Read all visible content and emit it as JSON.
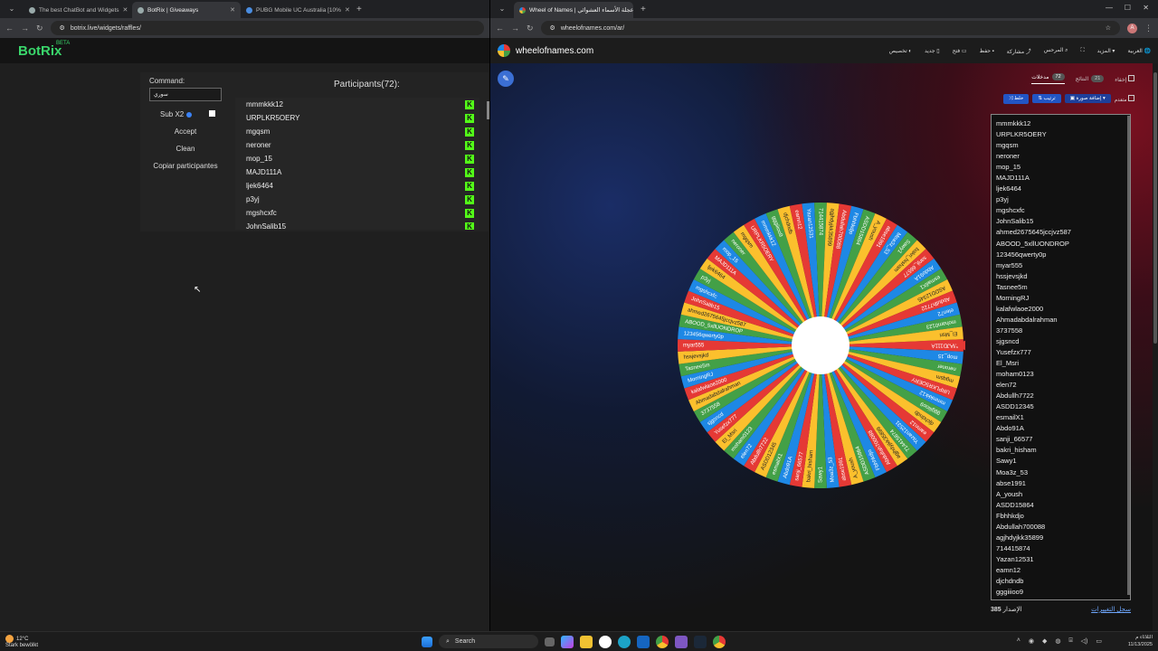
{
  "left_window": {
    "tabs": [
      {
        "title": "The best ChatBot and Widgets",
        "active": false
      },
      {
        "title": "BotRix | Giveaways",
        "active": true
      },
      {
        "title": "PUBG Mobile UC Australia [10%",
        "active": false
      }
    ],
    "url": "botrix.live/widgets/raffles/",
    "logo": "BotRix",
    "logo_badge": "BETA",
    "command_label": "Command:",
    "command_value": "سوري",
    "sub_label": "Sub X2",
    "accept_label": "Accept",
    "clean_label": "Clean",
    "copy_label": "Copiar participantes",
    "participants_title": "Participants(72):",
    "participant_badge": "K",
    "participants": [
      "mmmkkk12",
      "URPLKR5OERY",
      "mgqsm",
      "neroner",
      "mop_15",
      "MAJD111A",
      "ljek6464",
      "p3yj",
      "mgshcxfc",
      "JohnSalib15"
    ]
  },
  "right_window": {
    "tab_title": "Wheel of Names | عجلة الأسماء العشوائي",
    "url": "wheelofnames.com/ar/",
    "site_name": "wheelofnames.com",
    "menu": [
      "العربية",
      "المزيد",
      "المرحس",
      "مشاركة",
      "حفظ",
      "فتح",
      "جديد",
      "تخصيص"
    ],
    "side_tabs": [
      {
        "label": "مدخلات",
        "count": "72"
      },
      {
        "label": "النتائج",
        "count": "21"
      }
    ],
    "hide_label": "إخفاء",
    "buttons": [
      "إضافة صورة",
      "ترتيب",
      "خلط"
    ],
    "advanced_label": "متقدم",
    "names": [
      "mmmkkk12",
      "URPLKR5OERY",
      "mgqsm",
      "neroner",
      "mop_15",
      "MAJD111A",
      "ljek6464",
      "p3yj",
      "mgshcxfc",
      "JohnSalib15",
      "ahmed2675645jccjvz587",
      "ABOOD_5xllUONDROP",
      "123456qwerty0p",
      "myar555",
      "hssjevsjkd",
      "Tasnee5m",
      "MorningRJ",
      "kalafwlaoe2000",
      "Ahmadabdalrahman",
      "3737558",
      "sjgsncd",
      "Yusefzx777",
      "El_Msri",
      "moham0123",
      "elen72",
      "Abdullh7722",
      "ASDD12345",
      "esmailX1",
      "Abdo91A",
      "sanji_66577",
      "bakri_hisham",
      "Sawy1",
      "Moa3z_53",
      "abse1991",
      "A_yoush",
      "ASDD15864",
      "Fbhhkdjo",
      "Abdullah700088",
      "agjhdyjkk35899",
      "714415874",
      "Yazan12531",
      "eamn12",
      "djchdndb",
      "gggiiioo9"
    ],
    "version_label": "الإصدار",
    "version": "385",
    "changelog": "سجل التغييرات",
    "wheel": {
      "segment_colors": [
        "#e53935",
        "#1e88e5",
        "#43a047",
        "#fbc02d"
      ],
      "labels": [
        "MAJD111A",
        "mop_15",
        "neroner",
        "mgqsm",
        "URPLKR5OERY",
        "mmmkkk12",
        "gggiiioo9",
        "djchdndb",
        "eamn12",
        "Yazan12531",
        "714415874",
        "agjhdyjkk35899",
        "Abdullah700088",
        "Fbhhkdjo",
        "ASDD15864",
        "A_yoush",
        "abse1991",
        "Moa3z_53",
        "Sawy1",
        "bakri_hisham",
        "sanji_66577",
        "Abdo91A",
        "esmailX1",
        "ASDD12345",
        "Abdullh7722",
        "elen72",
        "moham0123",
        "El_Msri",
        "Yusefzx777",
        "sjgsncd",
        "3737558",
        "Ahmadabdalrahman",
        "kalafwlaoe2000",
        "MorningRJ",
        "Tasnee5m",
        "hssjevsjkd",
        "myar555",
        "123456qwerty0p",
        "ABOOD_5xllUONDROP",
        "ahmed2675645jccjvz587",
        "JohnSalib15",
        "mgshcxfc",
        "p3yj",
        "ljek6464"
      ]
    }
  },
  "taskbar": {
    "temp": "12°C",
    "weather": "Stark bewölkt",
    "search": "Search",
    "time": "الثلاثاء م",
    "date": "11/13/2025"
  }
}
